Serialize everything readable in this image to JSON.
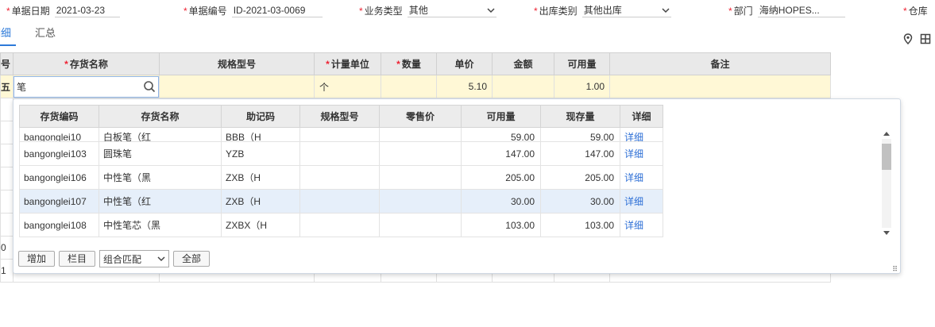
{
  "header": {
    "doc_date": {
      "label": "单据日期",
      "value": "2021-03-23"
    },
    "doc_no": {
      "label": "单据编号",
      "value": "ID-2021-03-0069"
    },
    "biz_type": {
      "label": "业务类型",
      "value": "其他"
    },
    "out_type": {
      "label": "出库类别",
      "value": "其他出库"
    },
    "dept": {
      "label": "部门",
      "value": "海纳HOPES..."
    },
    "warehouse": {
      "label": "仓库"
    }
  },
  "tabs": {
    "detail": "明细",
    "summary": "汇总"
  },
  "icons": {
    "location": "location-pin-icon",
    "layout": "layout-grid-icon",
    "search": "search-icon"
  },
  "grid": {
    "row_no_header": "号",
    "headers": {
      "name": "存货名称",
      "spec": "规格型号",
      "unit": "计量单位",
      "qty": "数量",
      "price": "单价",
      "amount": "金额",
      "available": "可用量",
      "remark": "备注"
    },
    "edit_row": {
      "no": "五",
      "name": "笔",
      "unit": "个",
      "price": "5.10",
      "available": "1.00"
    },
    "left_marks": [
      "0",
      "1"
    ]
  },
  "popup": {
    "headers": [
      "存货编码",
      "存货名称",
      "助记码",
      "规格型号",
      "零售价",
      "可用量",
      "现存量",
      "详细"
    ],
    "rows": [
      {
        "code": "bangonglei10",
        "name": "白板笔（红",
        "mnemonic": "BBB（H",
        "spec": "",
        "retail": "",
        "available": "59.00",
        "stock": "59.00",
        "detail": "详细"
      },
      {
        "code": "bangonglei103",
        "name": "圆珠笔",
        "mnemonic": "YZB",
        "spec": "",
        "retail": "",
        "available": "147.00",
        "stock": "147.00",
        "detail": "详细"
      },
      {
        "code": "bangonglei106",
        "name": "中性笔（黑",
        "mnemonic": "ZXB（H",
        "spec": "",
        "retail": "",
        "available": "205.00",
        "stock": "205.00",
        "detail": "详细"
      },
      {
        "code": "bangonglei107",
        "name": "中性笔（红",
        "mnemonic": "ZXB（H",
        "spec": "",
        "retail": "",
        "available": "30.00",
        "stock": "30.00",
        "detail": "详细"
      },
      {
        "code": "bangonglei108",
        "name": "中性笔芯（黑",
        "mnemonic": "ZXBX（H",
        "spec": "",
        "retail": "",
        "available": "103.00",
        "stock": "103.00",
        "detail": "详细"
      }
    ],
    "selected_index": 3,
    "footer": {
      "add": "增加",
      "columns": "栏目",
      "match_mode": "组合匹配",
      "all": "全部"
    }
  },
  "colors": {
    "accent": "#2d7ad9",
    "required": "#e23",
    "edit_row": "#fff8d6",
    "selected_row": "#e6effa"
  }
}
